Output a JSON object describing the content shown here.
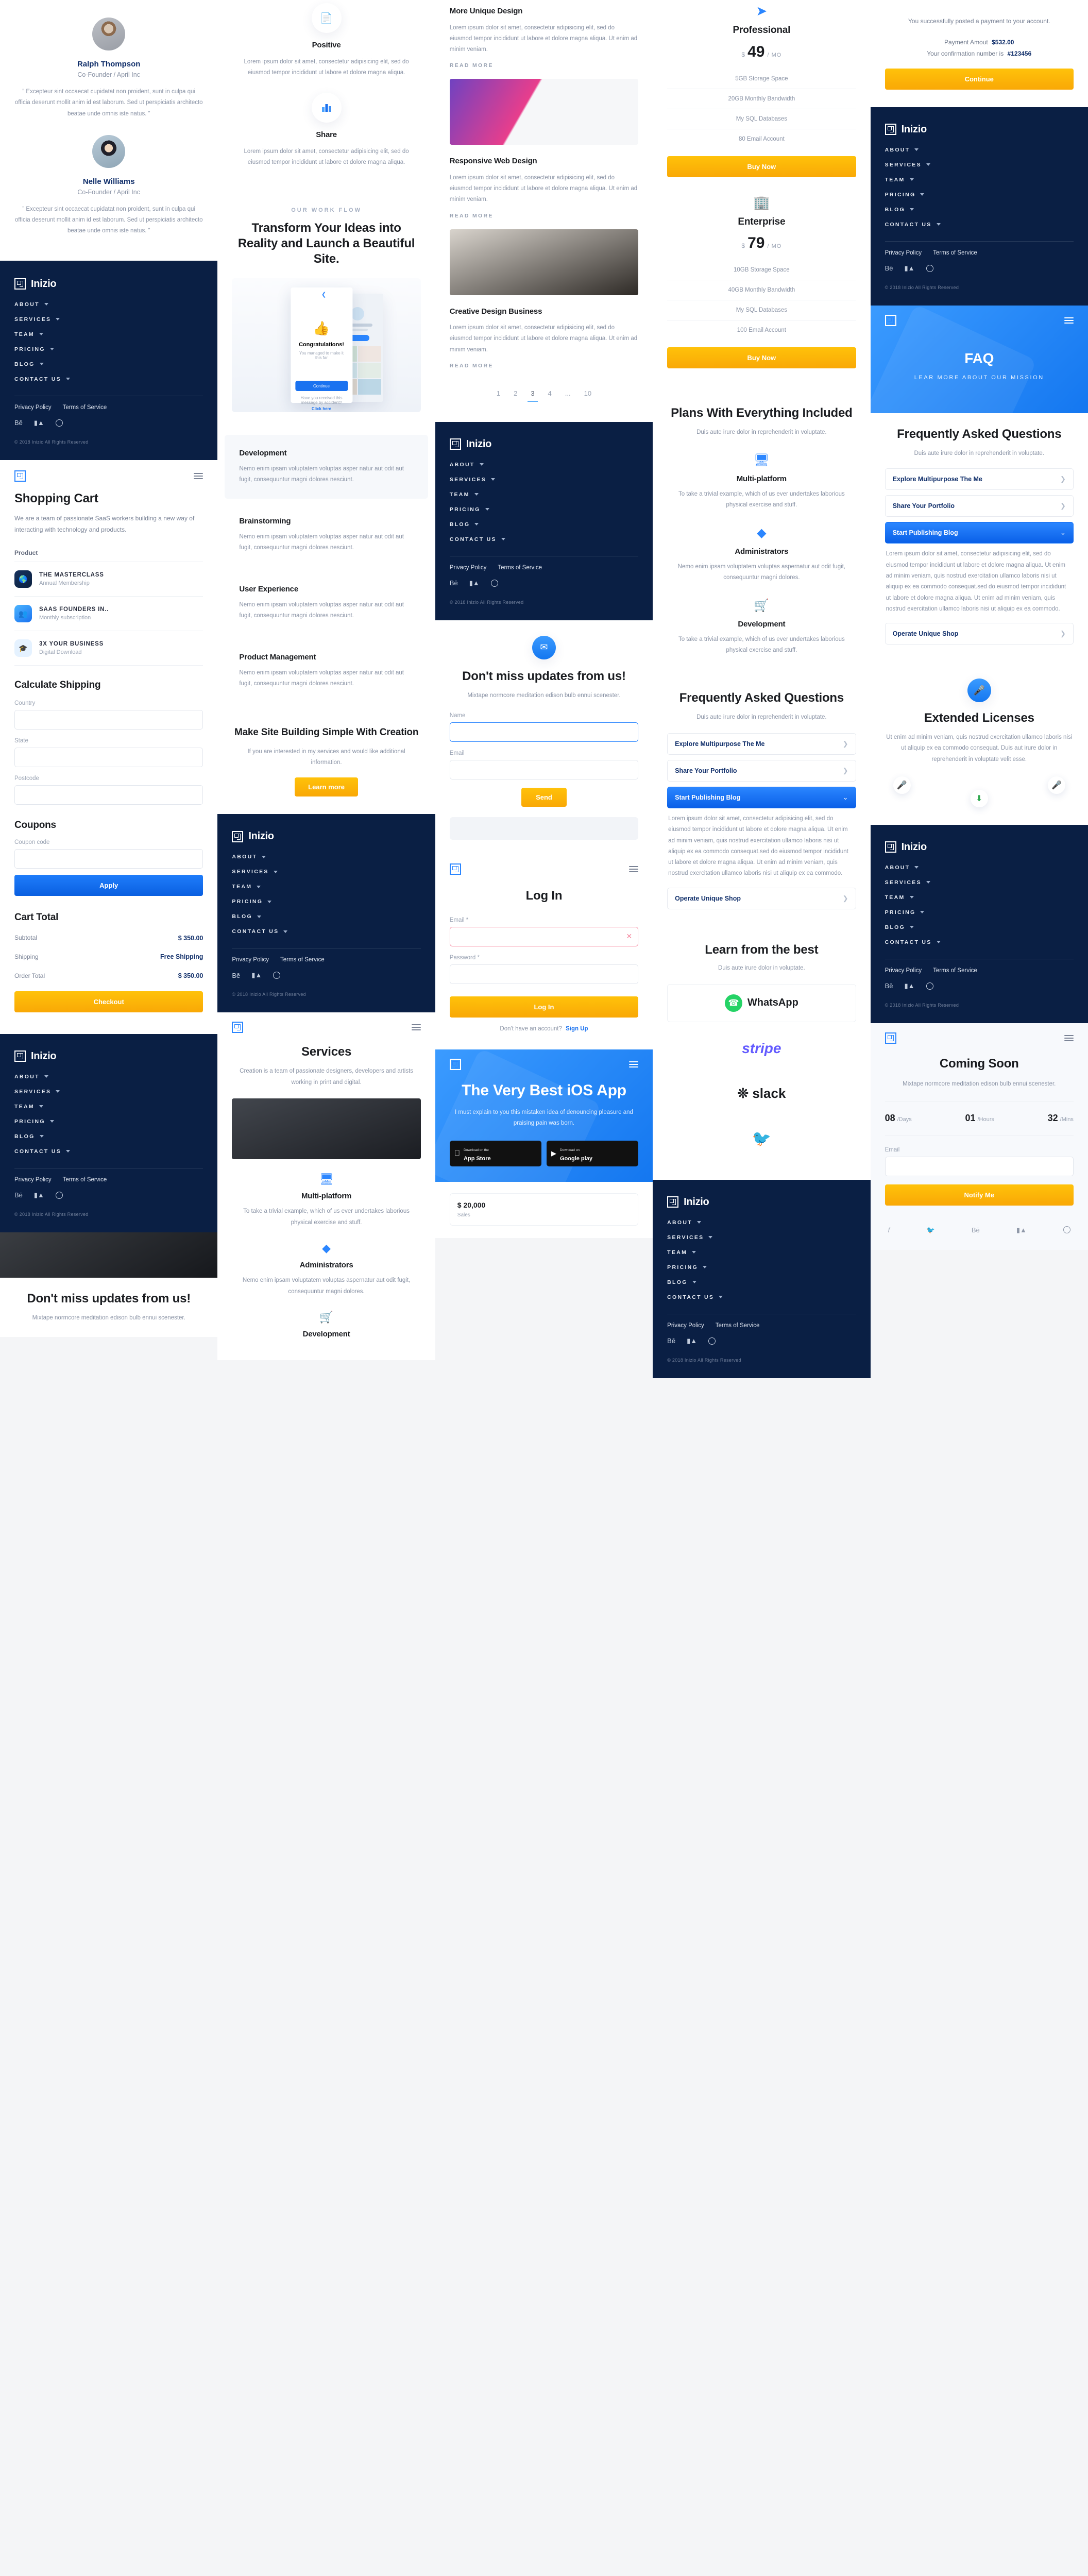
{
  "brand": {
    "name": "Inizio",
    "copyright": "© 2018 Inizio All Rights Reserved"
  },
  "colors": {
    "navy": "#0a1f44",
    "blue": "#1477f0",
    "amber": "#ffb300",
    "muted": "#8a93a5"
  },
  "nav": {
    "items": [
      {
        "label": "ABOUT"
      },
      {
        "label": "SERVICES"
      },
      {
        "label": "TEAM"
      },
      {
        "label": "PRICING"
      },
      {
        "label": "BLOG"
      },
      {
        "label": "CONTACT US"
      }
    ],
    "privacy": "Privacy Policy",
    "terms": "Terms of Service",
    "socials": [
      "behance-icon",
      "medium-icon",
      "dribbble-icon"
    ]
  },
  "testimonials": {
    "items": [
      {
        "name": "Ralph Thompson",
        "role": "Co-Founder / April Inc",
        "quote": "” Excepteur sint occaecat cupidatat non proident, sunt in culpa qui officia deserunt mollit anim id est laborum. Sed ut perspiciatis architecto beatae unde omnis iste natus. ”"
      },
      {
        "name": "Nelle Williams",
        "role": "Co-Founder / April Inc",
        "quote": "” Excepteur sint occaecat cupidatat non proident, sunt in culpa qui officia deserunt mollit anim id est laborum. Sed ut perspiciatis architecto beatae unde omnis iste natus. ”"
      }
    ]
  },
  "cart": {
    "title": "Shopping Cart",
    "intro": "We are a team of passionate SaaS workers building a new way of interacting with technology and products.",
    "product_header": "Product",
    "products": [
      {
        "title": "THE MASTERCLASS",
        "sub": "Annual Membership",
        "icon": "globe-icon"
      },
      {
        "title": "SAAS FOUNDERS IN..",
        "sub": "Monthly subscription",
        "icon": "users-icon"
      },
      {
        "title": "3X YOUR BUSINESS",
        "sub": "Digital Download",
        "icon": "graduation-cap-icon"
      }
    ],
    "shipping_title": "Calculate Shipping",
    "fields": [
      {
        "label": "Country",
        "value": ""
      },
      {
        "label": "State",
        "value": ""
      },
      {
        "label": "Postcode",
        "value": ""
      }
    ],
    "coupons_title": "Coupons",
    "coupon_label": "Coupon code",
    "coupon_value": "",
    "apply_label": "Apply",
    "total_title": "Cart Total",
    "totals": [
      {
        "label": "Subtotal",
        "value": "$ 350.00"
      },
      {
        "label": "Shipping",
        "value": "Free Shipping"
      },
      {
        "label": "Order Total",
        "value": "$ 350.00"
      }
    ],
    "checkout_label": "Checkout"
  },
  "features_small": {
    "items": [
      {
        "title": "Positive",
        "body": "Lorem ipsum dolor sit amet, consectetur adipisicing elit, sed do eiusmod tempor incididunt ut labore et dolore magna aliqua.",
        "icon": "document-icon"
      },
      {
        "title": "Share",
        "body": "Lorem ipsum dolor sit amet, consectetur adipisicing elit, sed do eiusmod tempor incididunt ut labore et dolore magna aliqua.",
        "icon": "bar-chart-icon"
      }
    ]
  },
  "workflow": {
    "eyebrow": "OUR WORK FLOW",
    "title": "Transform Your Ideas into Reality and Launch a Beautiful Site.",
    "phone_congrats": "Congratulations!",
    "phone_sub": "You managed to make it this far",
    "phone_cta": "Continue",
    "phone_note": "Have you received this message by accident?",
    "phone_link": "Click here",
    "steps": [
      {
        "title": "Development",
        "body": "Nemo enim ipsam voluptatem voluptas asper natur aut odit aut fugit, consequuntur magni dolores nesciunt."
      },
      {
        "title": "Brainstorming",
        "body": "Nemo enim ipsam voluptatem voluptas asper natur aut odit aut fugit, consequuntur magni dolores nesciunt."
      },
      {
        "title": "User Experience",
        "body": "Nemo enim ipsam voluptatem voluptas asper natur aut odit aut fugit, consequuntur magni dolores nesciunt."
      },
      {
        "title": "Product Management",
        "body": "Nemo enim ipsam voluptatem voluptas asper natur aut odit aut fugit, consequuntur magni dolores nesciunt."
      }
    ],
    "cta_title": "Make Site Building Simple With Creation",
    "cta_body": "If you are interested in my services and would like additional information.",
    "cta_button": "Learn more"
  },
  "services": {
    "title": "Services",
    "body": "Creation is a team of passionate designers, developers and artists working in print and digital.",
    "items": [
      {
        "title": "Multi-platform",
        "body": "To take a trivial example, which of us ever undertakes laborious physical exercise and stuff.",
        "icon": "monitor-icon"
      },
      {
        "title": "Administrators",
        "body": "Nemo enim ipsam voluptatem voluptas aspernatur aut odit fugit, consequuntur magni dolores.",
        "icon": "layers-icon"
      },
      {
        "title": "Development",
        "body": "To take a trivial example, which of us ever undertakes laborious physical exercise and stuff.",
        "icon": "cart-icon"
      }
    ]
  },
  "blog": {
    "posts": [
      {
        "title": "More Unique Design",
        "body": "Lorem ipsum dolor sit amet, consectetur adipisicing elit, sed do eiusmod tempor incididunt ut labore et dolore magna aliqua. Ut enim ad minim veniam.",
        "read_more": "READ MORE",
        "image": "design-workspace-photo"
      },
      {
        "title": "Responsive Web Design",
        "body": "Lorem ipsum dolor sit amet, consectetur adipisicing elit, sed do eiusmod tempor incididunt ut labore et dolore magna aliqua. Ut enim ad minim veniam.",
        "read_more": "READ MORE",
        "image": "desk-laptop-photo"
      },
      {
        "title": "Creative Design Business",
        "body": "Lorem ipsum dolor sit amet, consectetur adipisicing elit, sed do eiusmod tempor incididunt ut labore et dolore magna aliqua. Ut enim ad minim veniam.",
        "read_more": "READ MORE",
        "image": "office-chair-photo"
      }
    ],
    "pagination": [
      "1",
      "2",
      "3",
      "4",
      "...",
      "10"
    ],
    "current_page": "3"
  },
  "newsletter": {
    "icon": "envelope-icon",
    "title": "Don't miss updates from us!",
    "sub": "Mixtape normcore meditation edison bulb ennui scenester.",
    "name_label": "Name",
    "name_value": "",
    "email_label": "Email",
    "email_value": "",
    "send_label": "Send"
  },
  "login": {
    "title": "Log In",
    "email_label": "Email *",
    "email_value": "",
    "password_label": "Password *",
    "password_value": "",
    "submit_label": "Log In",
    "footer_text": "Don't have an account?",
    "footer_link": "Sign Up"
  },
  "ios": {
    "title": "The Very Best iOS App",
    "body": "I must explain to you this mistaken idea of denouncing pleasure and praising pain was born.",
    "appstore": {
      "small": "Download on the",
      "large": "App Store",
      "icon": "apple-icon"
    },
    "googleplay": {
      "small": "Download on",
      "large": "Google play",
      "icon": "google-play-icon"
    }
  },
  "pricing": {
    "plans": [
      {
        "name": "Professional",
        "currency": "$",
        "amount": "49",
        "period": "/ MO",
        "icon": "send-icon",
        "features": [
          "5GB Storage Space",
          "20GB Monthly Bandwidth",
          "My SQL Databases",
          "80 Email Account"
        ],
        "button": "Buy Now"
      },
      {
        "name": "Enterprise",
        "currency": "$",
        "amount": "79",
        "period": "/ MO",
        "icon": "building-icon",
        "features": [
          "10GB Storage Space",
          "40GB Monthly Bandwidth",
          "My SQL Databases",
          "100 Email Account"
        ],
        "button": "Buy Now"
      }
    ],
    "included_title": "Plans With Everything Included",
    "included_sub": "Duis aute irure dolor in reprehenderit in voluptate.",
    "included_items": [
      {
        "title": "Multi-platform",
        "body": "To take a trivial example, which of us ever undertakes laborious physical exercise and stuff.",
        "icon": "monitor-icon"
      },
      {
        "title": "Administrators",
        "body": "Nemo enim ipsam voluptatem voluptas aspernatur aut odit fugit, consequuntur magni dolores.",
        "icon": "layers-icon"
      },
      {
        "title": "Development",
        "body": "To take a trivial example, which of us ever undertakes laborious physical exercise and stuff.",
        "icon": "cart-icon"
      }
    ]
  },
  "faq": {
    "title": "Frequently Asked Questions",
    "sub": "Duis aute irure dolor in reprehenderit in voluptate.",
    "items": [
      {
        "q": "Explore Multipurpose The Me",
        "state": "collapsed",
        "icon": "chevron-right-icon"
      },
      {
        "q": "Share Your Portfolio",
        "state": "collapsed",
        "icon": "chevron-right-icon"
      },
      {
        "q": "Start Publishing Blog",
        "state": "expanded",
        "icon": "chevron-down-icon",
        "a": "Lorem ipsum dolor sit amet, consectetur adipisicing elit, sed do eiusmod tempor incididunt ut labore et dolore magna aliqua. Ut enim ad minim veniam, quis nostrud exercitation ullamco laboris nisi ut aliquip ex ea commodo consequat.sed do eiusmod tempor incididunt ut labore et dolore magna aliqua. Ut enim ad minim veniam, quis nostrud exercitation ullamco laboris nisi ut aliquip ex ea commodo."
      },
      {
        "q": "Operate Unique Shop",
        "state": "collapsed",
        "icon": "chevron-right-icon"
      }
    ],
    "hero_title": "FAQ",
    "hero_sub": "LEAR MORE ABOUT OUR MISSION"
  },
  "brands": {
    "title": "Learn from the best",
    "sub": "Duis aute irure dolor in voluptate.",
    "items": [
      "whatsapp-logo",
      "stripe-logo",
      "slack-logo",
      "twitter-logo"
    ]
  },
  "payment": {
    "message": "You successfully posted a payment to your account.",
    "amount_label": "Payment Amout",
    "amount_value": "$532.00",
    "confirmation_label": "Your confirmation number is",
    "confirmation_value": "#123456",
    "button": "Continue"
  },
  "licenses": {
    "icon": "microphone-icon",
    "title": "Extended Licenses",
    "body": "Ut enim ad minim veniam, quis nostrud exercitation ullamco laboris nisi ut aliquip ex ea commodo consequat. Duis aut irure dolor in reprehenderit in voluptate velit esse.",
    "badges": [
      "microphone-icon",
      "download-icon",
      "microphone-icon"
    ]
  },
  "coming_soon": {
    "title": "Coming Soon",
    "sub": "Mixtape normcore meditation edison bulb ennui scenester.",
    "countdown": [
      {
        "value": "08",
        "unit": "/Days"
      },
      {
        "value": "01",
        "unit": "/Hours"
      },
      {
        "value": "32",
        "unit": "/Mins"
      }
    ],
    "email_label": "Email",
    "email_value": "",
    "button": "Notify Me",
    "socials": [
      "facebook-icon",
      "twitter-icon",
      "behance-icon",
      "medium-icon",
      "dribbble-icon"
    ]
  },
  "chart_card": {
    "value": "$ 20,000",
    "label": "Sales"
  }
}
